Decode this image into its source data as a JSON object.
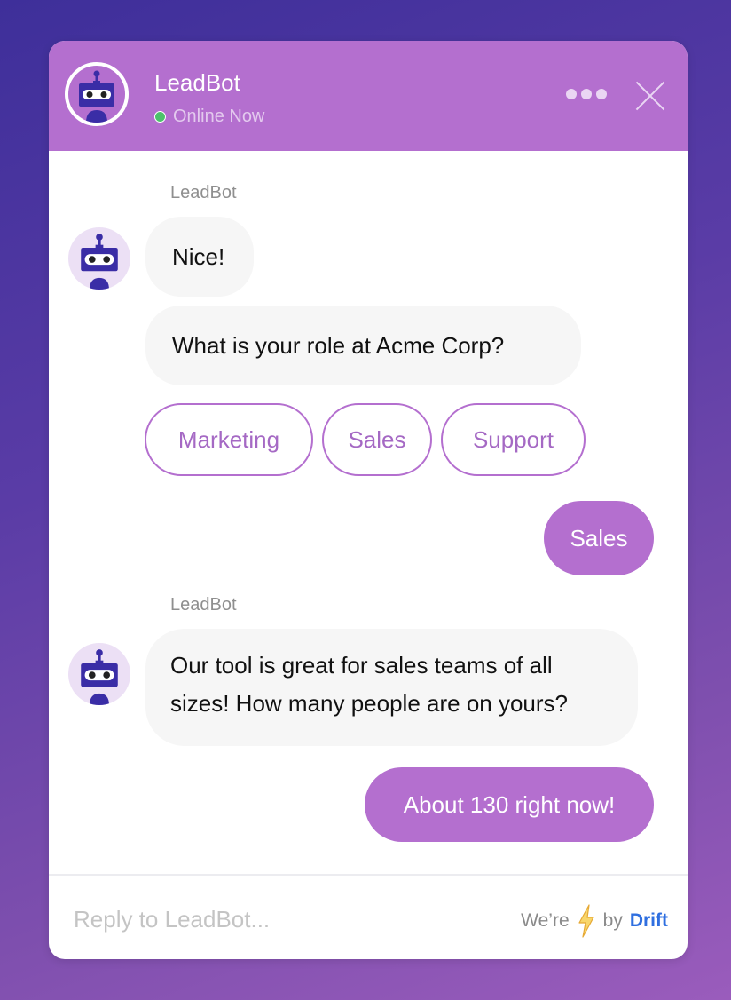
{
  "header": {
    "bot_name": "LeadBot",
    "status": "Online Now",
    "status_color": "#4cc26c",
    "more_icon": "ellipsis-icon",
    "close_icon": "close-icon"
  },
  "conversation": {
    "block1": {
      "sender": "LeadBot",
      "messages": [
        "Nice!",
        "What is your role at Acme Corp?"
      ],
      "options": [
        "Marketing",
        "Sales",
        "Support"
      ]
    },
    "user_reply1": "Sales",
    "block2": {
      "sender": "LeadBot",
      "message_line1": "Our tool is great for sales teams of all",
      "message_line2": "sizes! How many people are on yours?"
    },
    "user_reply2": "About 130 right now!"
  },
  "footer": {
    "reply_placeholder": "Reply to LeadBot...",
    "powered_prefix": "We’re",
    "powered_icon": "lightning-bolt-icon",
    "powered_by": "by",
    "brand": "Drift"
  },
  "colors": {
    "accent": "#b46fcf",
    "brand_link": "#2f6fe0",
    "bot_bubble": "#f6f6f6"
  }
}
